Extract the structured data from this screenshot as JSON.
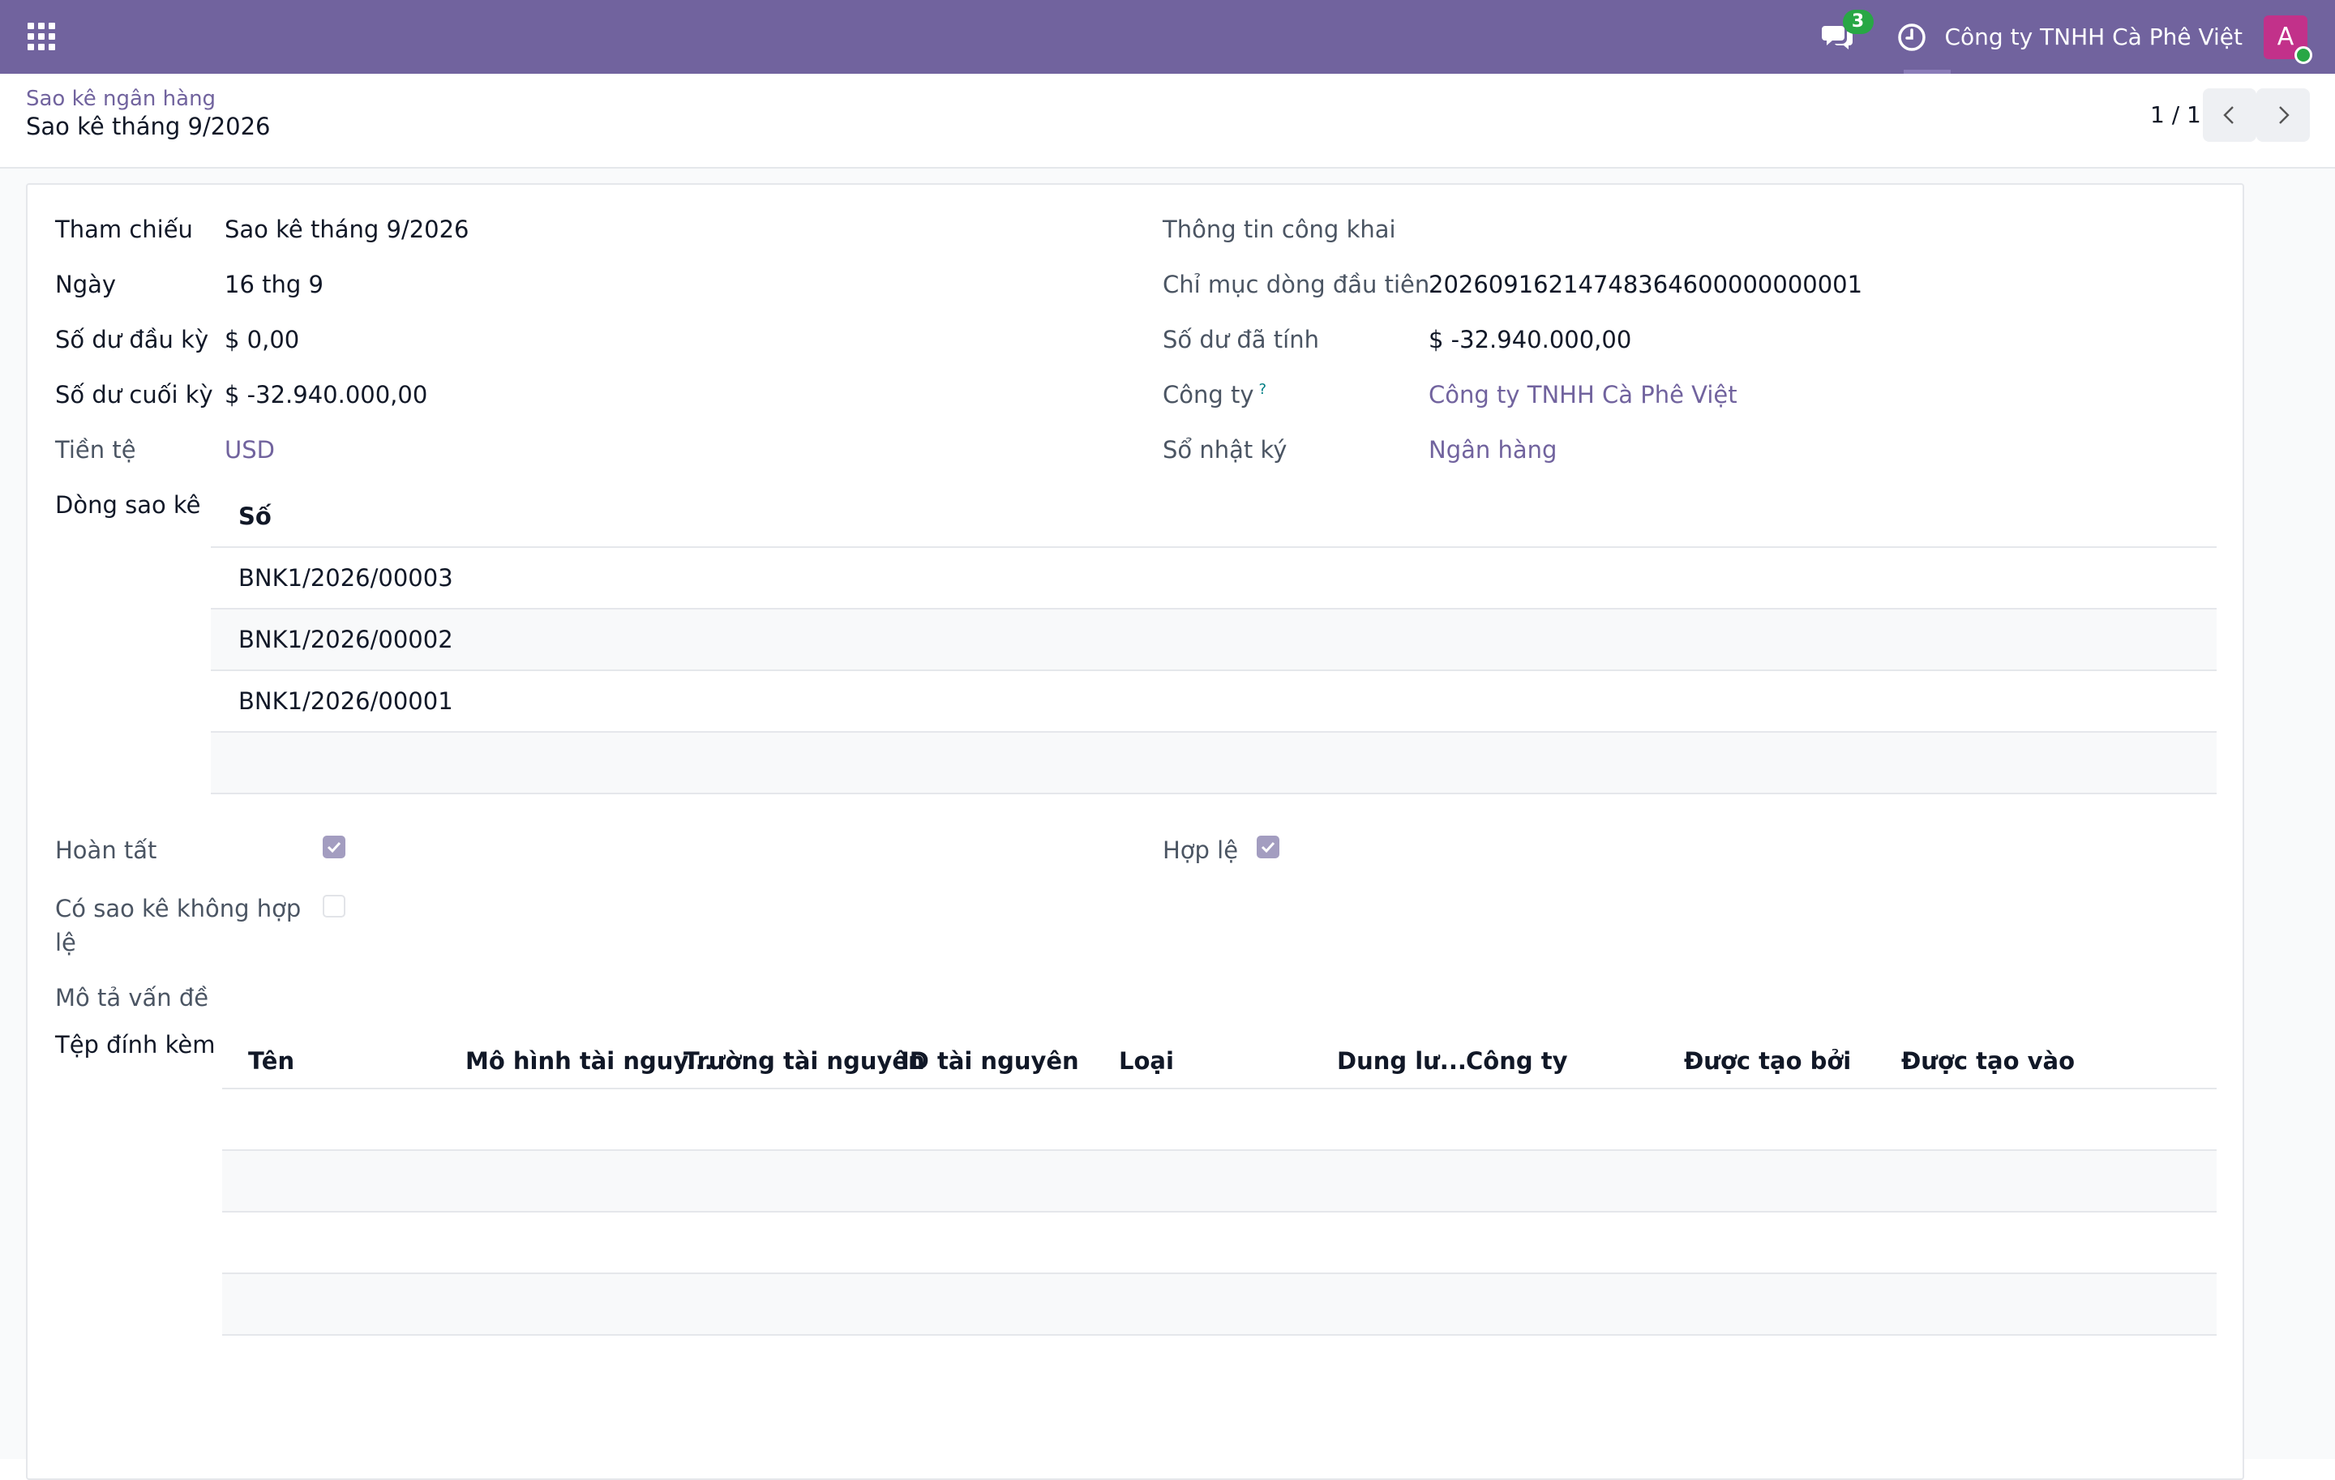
{
  "navbar": {
    "chat_count": "3",
    "company": "Công ty TNHH Cà Phê Việt",
    "avatar_initial": "A",
    "brand_color": "#71639e"
  },
  "breadcrumb": {
    "parent": "Sao kê ngân hàng",
    "current": "Sao kê tháng 9/2026"
  },
  "pager": {
    "value": "1 / 1"
  },
  "form": {
    "left": {
      "reference_label": "Tham chiếu",
      "reference_value": "Sao kê tháng 9/2026",
      "date_label": "Ngày",
      "date_value": "16 thg 9",
      "opening_label": "Số dư đầu kỳ",
      "opening_value": "$ 0,00",
      "closing_label": "Số dư cuối kỳ",
      "closing_value": "$ -32.940.000,00",
      "currency_label": "Tiền tệ",
      "currency_value": "USD"
    },
    "right": {
      "public_info_label": "Thông tin công khai",
      "first_line_index_label": "Chỉ mục dòng đầu tiên",
      "first_line_index_value": "20260916214748364600000000001",
      "computed_balance_label": "Số dư đã tính",
      "computed_balance_value": "$ -32.940.000,00",
      "company_label": "Công ty",
      "company_tip": "?",
      "company_value": "Công ty TNHH Cà Phê Việt",
      "journal_label": "Sổ nhật ký",
      "journal_value": "Ngân hàng"
    },
    "statement_lines": {
      "label": "Dòng sao kê",
      "column": "Số",
      "rows": [
        "BNK1/2026/00003",
        "BNK1/2026/00002",
        "BNK1/2026/00001"
      ]
    },
    "flags": {
      "complete_label": "Hoàn tất",
      "complete": true,
      "valid_label": "Hợp lệ",
      "valid": true,
      "invalid_label_line1": "Có sao kê không hợp",
      "invalid_label_line2": "lệ",
      "invalid": false,
      "problem_label": "Mô tả vấn đề"
    },
    "attachments": {
      "label": "Tệp đính kèm",
      "columns": [
        "Tên",
        "Mô hình tài nguy...",
        "Trường tài nguyên",
        "ID tài nguyên",
        "Loại",
        "Dung lư...",
        "Công ty",
        "Được tạo bởi",
        "Được tạo vào"
      ]
    }
  }
}
